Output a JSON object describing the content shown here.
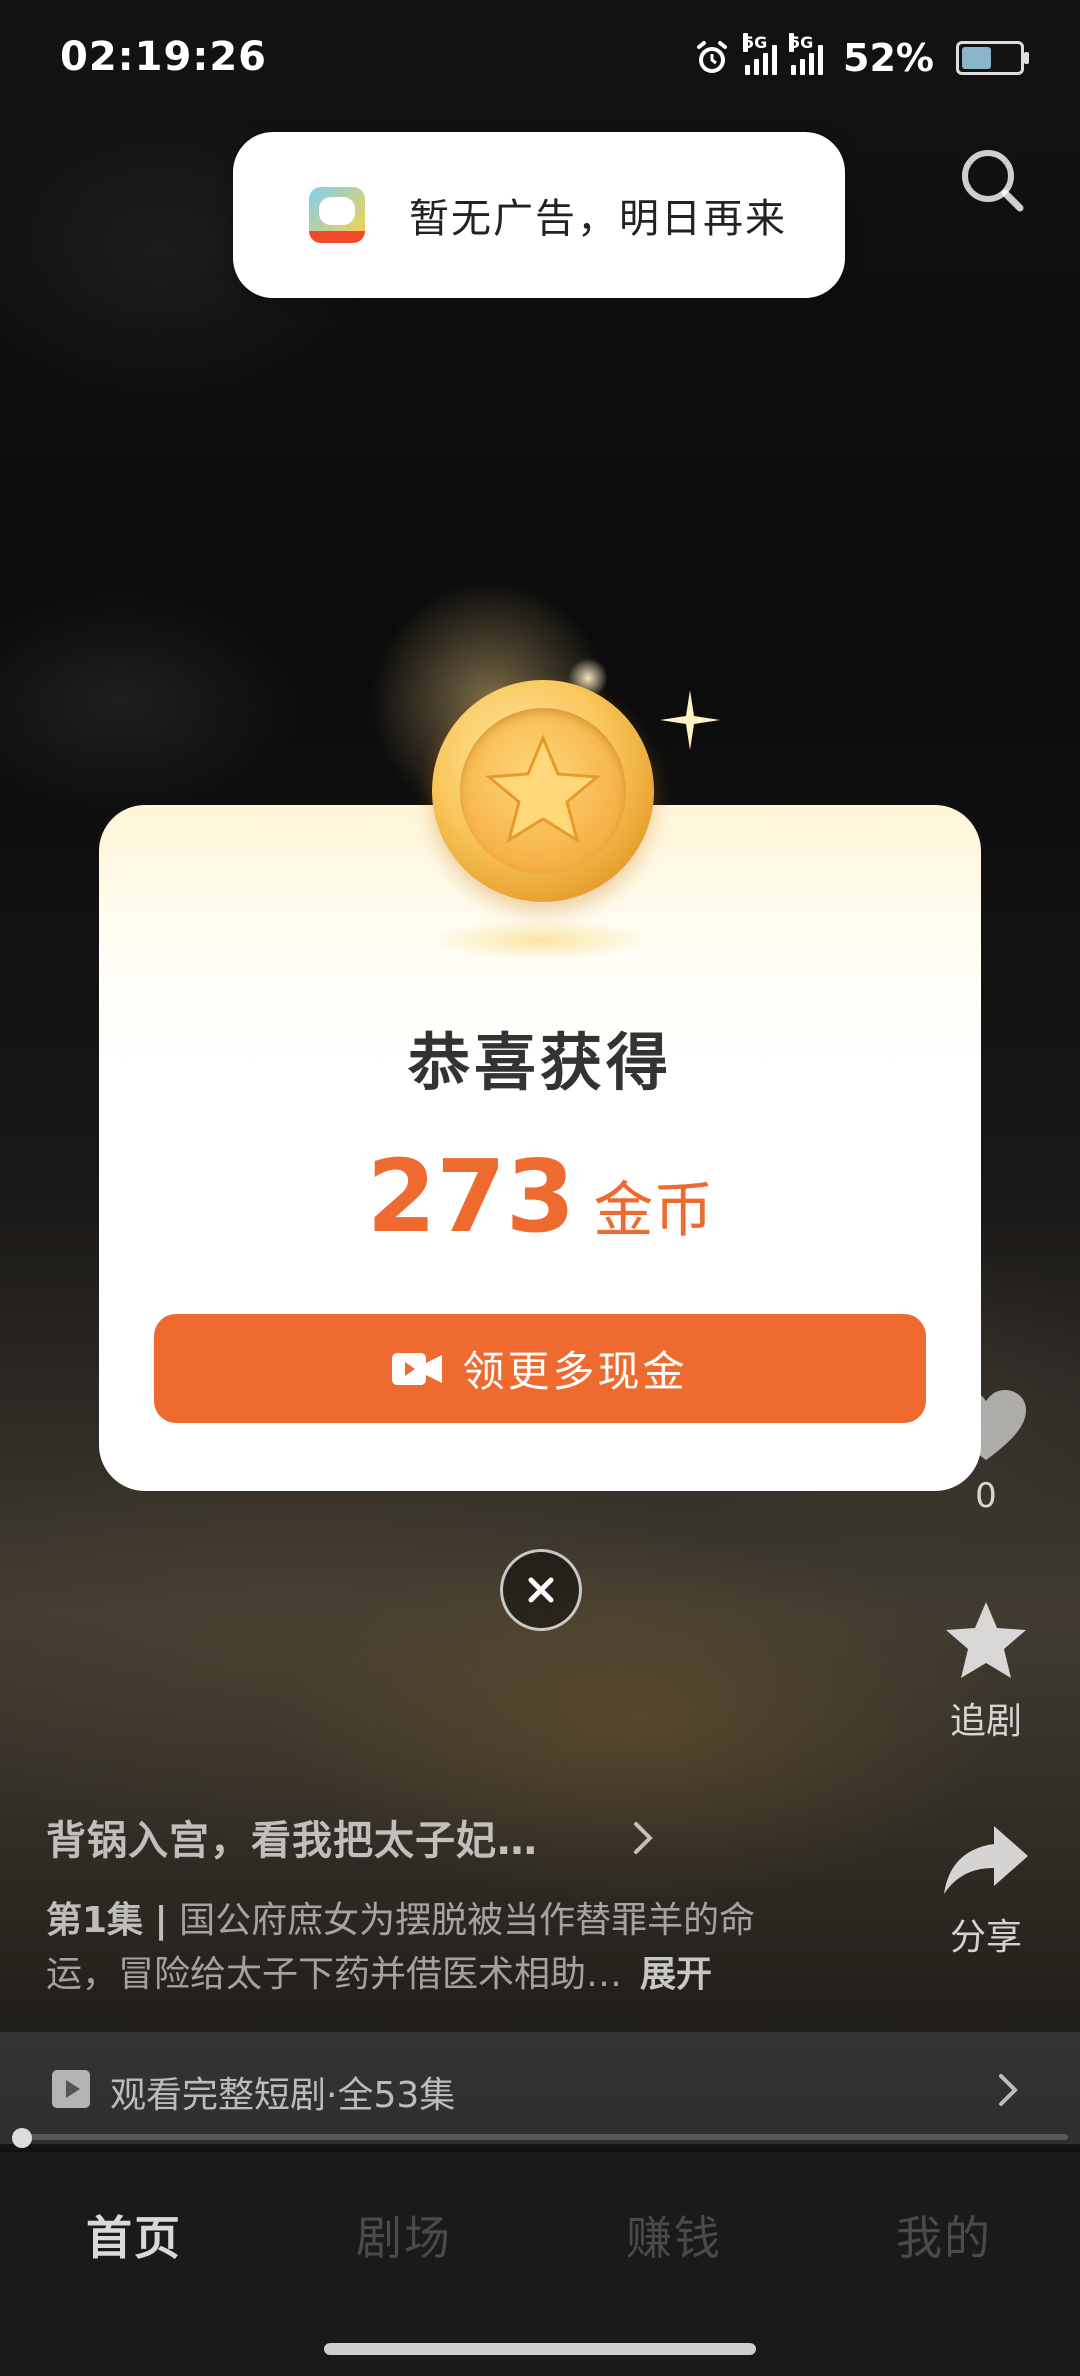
{
  "status_bar": {
    "time": "02:19:26",
    "net1": "5G",
    "net2": "5G",
    "battery_percent": "52%",
    "battery_level": 0.52
  },
  "toast": {
    "message": "暂无广告，明日再来"
  },
  "reward_modal": {
    "title": "恭喜获得",
    "amount": "273",
    "unit": "金币",
    "cta_label": "领更多现金"
  },
  "right_rail": {
    "like_count": "0",
    "follow_label": "追剧",
    "share_label": "分享"
  },
  "drama": {
    "title": "背锅入宫，看我把太子妃…",
    "episode": "第1集",
    "separator": "|",
    "description": "国公府庶女为摆脱被当作替罪羊的命运，冒险给太子下药并借医术相助…",
    "expand_label": "展开",
    "watch_full_label": "观看完整短剧·全53集",
    "progress": 0.0
  },
  "bottom_nav": {
    "items": [
      "首页",
      "剧场",
      "赚钱",
      "我的"
    ],
    "active_index": 0
  },
  "colors": {
    "accent": "#ef6a2f",
    "modal_bg": "#ffffff",
    "nav_bg": "#1a1a1a"
  }
}
